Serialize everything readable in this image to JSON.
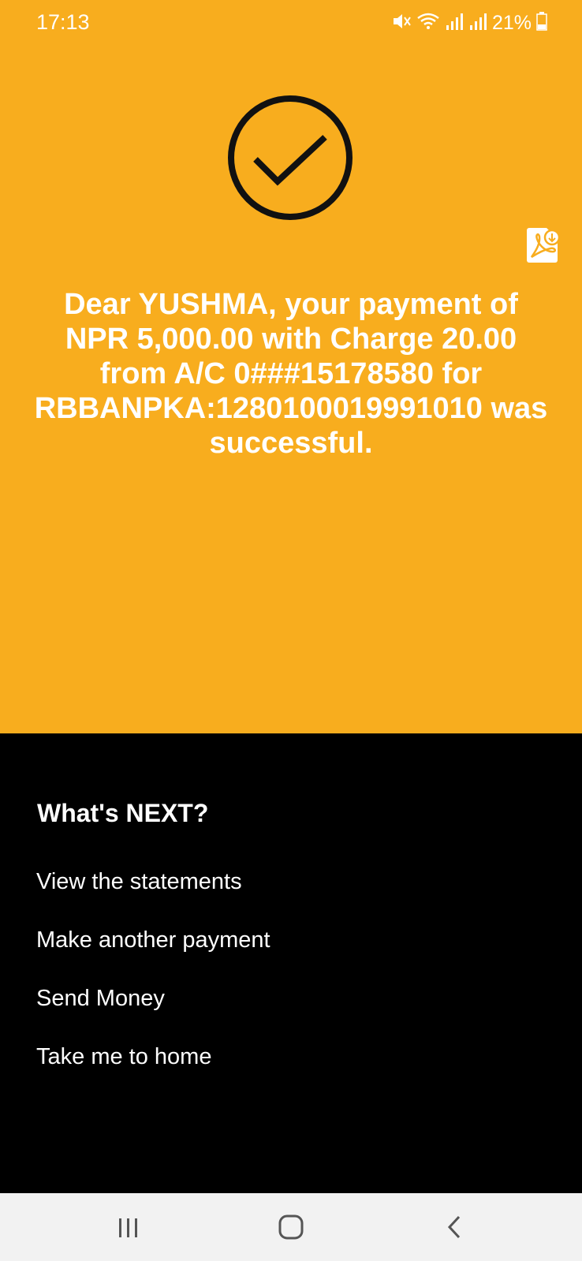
{
  "status_bar": {
    "time": "17:13",
    "battery": "21%",
    "icons": [
      "mute-icon",
      "wifi-icon",
      "signal-icon",
      "signal-icon",
      "battery-icon"
    ]
  },
  "success": {
    "icon": "check-circle-icon",
    "pdf_icon": "pdf-download-icon",
    "message": "Dear YUSHMA, your payment of NPR 5,000.00 with Charge 20.00 from A/C 0###15178580 for RBBANPKA:1280100019991010 was successful."
  },
  "next": {
    "title": "What's NEXT?",
    "items": [
      {
        "label": "View the statements"
      },
      {
        "label": "Make another payment"
      },
      {
        "label": "Send Money"
      },
      {
        "label": "Take me to home"
      }
    ]
  },
  "navbar": {
    "icons": [
      "recent-apps-icon",
      "home-icon",
      "back-icon"
    ]
  },
  "colors": {
    "accent": "#F8AD1E",
    "background": "#000000",
    "navbar": "#F2F2F2"
  }
}
